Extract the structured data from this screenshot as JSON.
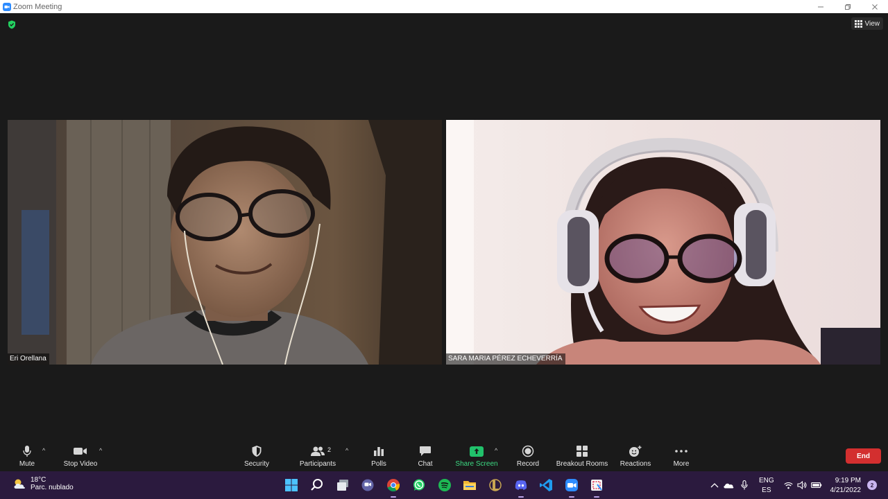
{
  "window": {
    "title": "Zoom Meeting",
    "controls": [
      "minimize",
      "restore",
      "close"
    ]
  },
  "meeting": {
    "view_label": "View",
    "participants": [
      {
        "name": "Eri Orellana"
      },
      {
        "name": "SARA MARIA PÉREZ ECHEVERRÍA"
      }
    ]
  },
  "toolbar": {
    "mute": "Mute",
    "stop_video": "Stop Video",
    "security": "Security",
    "participants": "Participants",
    "participants_count": "2",
    "polls": "Polls",
    "chat": "Chat",
    "share_screen": "Share Screen",
    "record": "Record",
    "breakout_rooms": "Breakout Rooms",
    "reactions": "Reactions",
    "more": "More",
    "end": "End"
  },
  "taskbar": {
    "weather_temp": "18°C",
    "weather_condition": "Parc. nublado",
    "apps": [
      "windows-start",
      "search",
      "task-view",
      "teams-chat",
      "chrome",
      "whatsapp",
      "spotify",
      "file-explorer",
      "league-of-legends",
      "discord",
      "vscode",
      "zoom",
      "snipping-tool"
    ],
    "lang_primary": "ENG",
    "lang_secondary": "ES",
    "time": "9:19 PM",
    "date": "4/21/2022",
    "notifications": "2"
  },
  "colors": {
    "accent": "#2d8cff",
    "share_green": "#21c16b",
    "end_red": "#d32f2f",
    "taskbar": "#2b1a3e"
  }
}
